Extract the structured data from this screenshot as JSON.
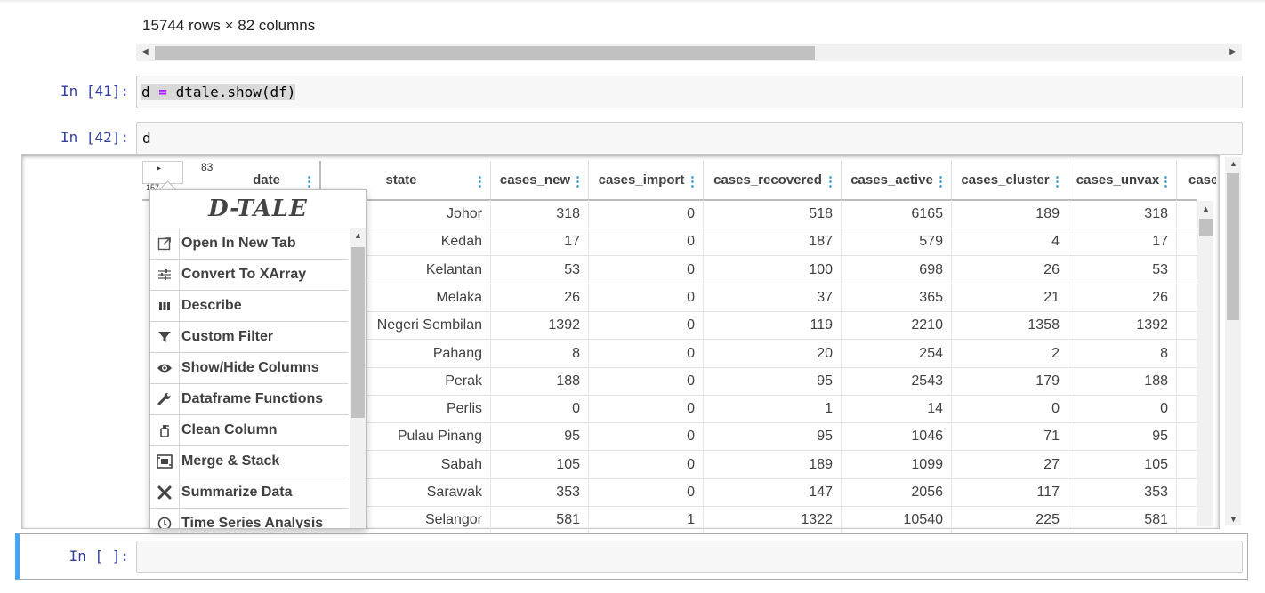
{
  "output": {
    "shape_text": "15744 rows × 82 columns"
  },
  "cells": [
    {
      "prompt": "In [41]:",
      "code_var": "d",
      "code_op": "=",
      "code_rest": "dtale.show(df)"
    },
    {
      "prompt": "In [42]:",
      "code": "d"
    },
    {
      "prompt": "In [ ]:"
    }
  ],
  "dtale": {
    "corner": {
      "play": "▸",
      "count": "83",
      "sub": "157"
    },
    "columns": [
      "date",
      "state",
      "cases_new",
      "cases_import",
      "cases_recovered",
      "cases_active",
      "cases_cluster",
      "cases_unvax",
      "case"
    ],
    "rows": [
      [
        "Johor",
        "318",
        "0",
        "518",
        "6165",
        "189",
        "318"
      ],
      [
        "Kedah",
        "17",
        "0",
        "187",
        "579",
        "4",
        "17"
      ],
      [
        "Kelantan",
        "53",
        "0",
        "100",
        "698",
        "26",
        "53"
      ],
      [
        "Melaka",
        "26",
        "0",
        "37",
        "365",
        "21",
        "26"
      ],
      [
        "Negeri Sembilan",
        "1392",
        "0",
        "119",
        "2210",
        "1358",
        "1392"
      ],
      [
        "Pahang",
        "8",
        "0",
        "20",
        "254",
        "2",
        "8"
      ],
      [
        "Perak",
        "188",
        "0",
        "95",
        "2543",
        "179",
        "188"
      ],
      [
        "Perlis",
        "0",
        "0",
        "1",
        "14",
        "0",
        "0"
      ],
      [
        "Pulau Pinang",
        "95",
        "0",
        "95",
        "1046",
        "71",
        "95"
      ],
      [
        "Sabah",
        "105",
        "0",
        "189",
        "1099",
        "27",
        "105"
      ],
      [
        "Sarawak",
        "353",
        "0",
        "147",
        "2056",
        "117",
        "353"
      ],
      [
        "Selangor",
        "581",
        "1",
        "1322",
        "10540",
        "225",
        "581"
      ]
    ],
    "menu": {
      "logo": "D-TALE",
      "items": [
        {
          "label": "Open In New Tab",
          "icon": "open-in-new-tab-icon"
        },
        {
          "label": "Convert To XArray",
          "icon": "sliders-icon"
        },
        {
          "label": "Describe",
          "icon": "bar-columns-icon"
        },
        {
          "label": "Custom Filter",
          "icon": "filter-icon"
        },
        {
          "label": "Show/Hide Columns",
          "icon": "eye-icon"
        },
        {
          "label": "Dataframe Functions",
          "icon": "wrench-icon"
        },
        {
          "label": "Clean Column",
          "icon": "spray-bottle-icon"
        },
        {
          "label": "Merge & Stack",
          "icon": "merge-icon"
        },
        {
          "label": "Summarize Data",
          "icon": "tools-icon"
        },
        {
          "label": "Time Series Analysis",
          "icon": "clock-icon"
        }
      ]
    }
  }
}
